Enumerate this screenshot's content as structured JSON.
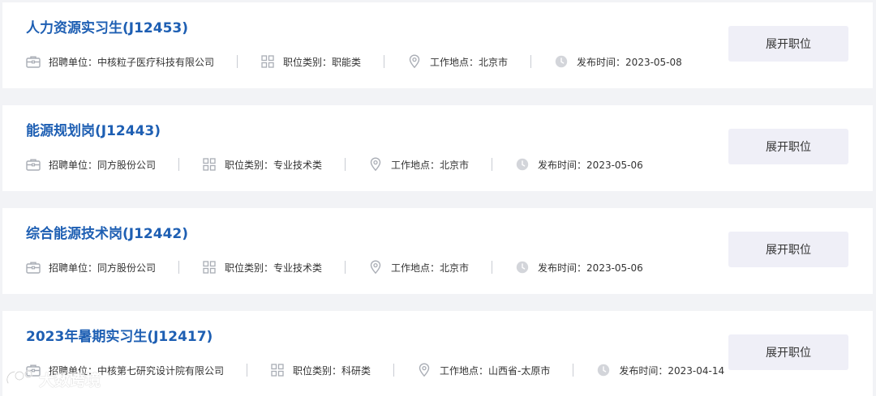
{
  "jobs": [
    {
      "title": "人力资源实习生(J12453)",
      "company": "招聘单位：中核粒子医疗科技有限公司",
      "category": "职位类别：职能类",
      "location": "工作地点：北京市",
      "date": "发布时间：2023-05-08",
      "button": "展开职位"
    },
    {
      "title": "能源规划岗(J12443)",
      "company": "招聘单位：同方股份公司",
      "category": "职位类别：专业技术类",
      "location": "工作地点：北京市",
      "date": "发布时间：2023-05-06",
      "button": "展开职位"
    },
    {
      "title": "综合能源技术岗(J12442)",
      "company": "招聘单位：同方股份公司",
      "category": "职位类别：专业技术类",
      "location": "工作地点：北京市",
      "date": "发布时间：2023-05-06",
      "button": "展开职位"
    },
    {
      "title": "2023年暑期实习生(J12417)",
      "company": "招聘单位：中核第七研究设计院有限公司",
      "category": "职位类别：科研类",
      "location": "工作地点：山西省-太原市",
      "date": "发布时间：2023-04-14",
      "button": "展开职位"
    }
  ],
  "watermark": "大数跨境",
  "icons": {
    "company": "briefcase-icon",
    "category": "grid-icon",
    "location": "location-pin-icon",
    "date": "clock-icon"
  },
  "colors": {
    "title": "#1e5fb3",
    "button_bg": "#efeff7",
    "icon": "#a9adb5"
  }
}
